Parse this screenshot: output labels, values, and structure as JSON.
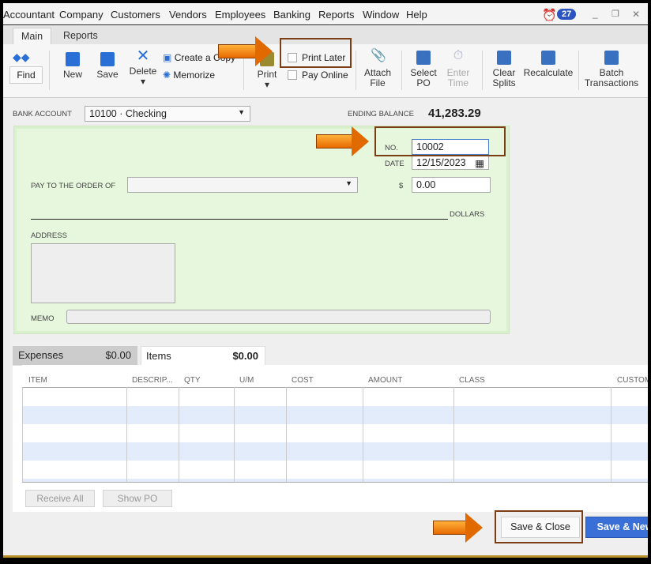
{
  "menu": [
    "Accountant",
    "Company",
    "Customers",
    "Vendors",
    "Employees",
    "Banking",
    "Reports",
    "Window",
    "Help"
  ],
  "reminder_count": "27",
  "window_controls": {
    "minimize": "_",
    "restore": "❐",
    "close": "✕"
  },
  "tabs": [
    "Main",
    "Reports"
  ],
  "toolbar": {
    "find": "Find",
    "new": "New",
    "save": "Save",
    "delete": "Delete",
    "create_copy": "Create a Copy",
    "memorize": "Memorize",
    "print": "Print",
    "print_later": "Print Later",
    "pay_online": "Pay Online",
    "attach_file": "Attach File",
    "select_po": "Select PO",
    "enter_time": "Enter Time",
    "clear_splits": "Clear Splits",
    "recalculate": "Recalculate",
    "batch_transactions": "Batch Transactions"
  },
  "form": {
    "bank_account_label": "BANK ACCOUNT",
    "bank_account": "10100 · Checking",
    "ending_balance_label": "ENDING BALANCE",
    "ending_balance": "41,283.29",
    "no_label": "NO.",
    "no": "10002",
    "date_label": "DATE",
    "date": "12/15/2023",
    "pay_to_label": "PAY TO THE ORDER OF",
    "pay_to": "",
    "amount_symbol": "$",
    "amount": "0.00",
    "dollars_label": "DOLLARS",
    "address_label": "ADDRESS",
    "memo_label": "MEMO"
  },
  "detail_tabs": [
    {
      "label": "Expenses",
      "amount": "$0.00"
    },
    {
      "label": "Items",
      "amount": "$0.00"
    }
  ],
  "columns": [
    "ITEM",
    "DESCRIP...",
    "QTY",
    "U/M",
    "COST",
    "AMOUNT",
    "CLASS",
    "CUSTOMER"
  ],
  "buttons": {
    "receive_all": "Receive All",
    "show_po": "Show PO",
    "save_close": "Save & Close",
    "save_new": "Save & New"
  },
  "colors": {
    "accent": "#3a6fd8",
    "check_bg": "#e6f7dd",
    "highlight": "#7a3d14",
    "arrow": "#f08010"
  }
}
